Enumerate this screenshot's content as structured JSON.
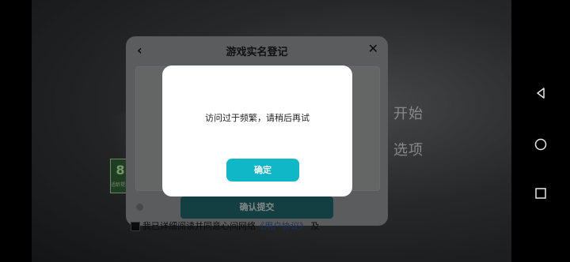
{
  "game": {
    "menu": [
      "开始",
      "选项"
    ],
    "age_rating": {
      "number": "8",
      "caption": "适龄提示"
    }
  },
  "registration_dialog": {
    "title": "游戏实名登记",
    "back_icon": "chevron-left-icon",
    "close_icon": "close-icon",
    "submit_label": "确认提交",
    "agreement_prefix": "我已详细阅读并同意心间网络",
    "agreement_link": "《用户协议》",
    "agreement_and": "及"
  },
  "alert": {
    "message": "访问过于频繁，请稍后再试",
    "confirm_label": "确定"
  },
  "colors": {
    "accent": "#10b7c7",
    "submit": "#1f6166"
  },
  "android_nav": [
    "back-icon",
    "home-icon",
    "recents-icon"
  ]
}
